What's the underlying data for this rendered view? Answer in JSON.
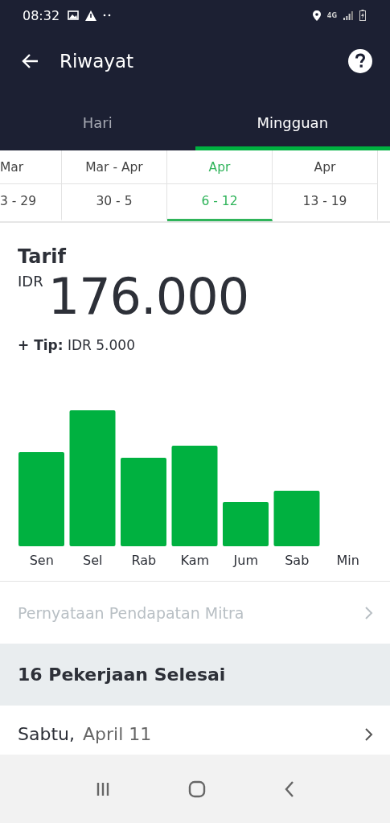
{
  "status_bar": {
    "time": "08:32",
    "network": "4G"
  },
  "header": {
    "title": "Riwayat"
  },
  "tabs": [
    {
      "label": "Hari",
      "selected": false
    },
    {
      "label": "Mingguan",
      "selected": true
    }
  ],
  "weeks": [
    {
      "month": "Mar",
      "range": "3 - 29",
      "selected": false
    },
    {
      "month": "Mar - Apr",
      "range": "30 - 5",
      "selected": false
    },
    {
      "month": "Apr",
      "range": "6 - 12",
      "selected": true
    },
    {
      "month": "Apr",
      "range": "13 - 19",
      "selected": false
    }
  ],
  "fare": {
    "title": "Tarif",
    "currency": "IDR",
    "amount": "176.000",
    "tip_label": "+ Tip:",
    "tip_value": "IDR 5.000"
  },
  "chart": {
    "days": [
      "Sen",
      "Sel",
      "Rab",
      "Kam",
      "Jum",
      "Sab",
      "Min"
    ]
  },
  "statement_link": {
    "label": "Pernyataan Pendapatan Mitra",
    "disabled": true
  },
  "jobs": {
    "heading": "16 Pekerjaan Selesai",
    "items": [
      {
        "day": "Sabtu,",
        "date": "April 11"
      }
    ]
  }
}
